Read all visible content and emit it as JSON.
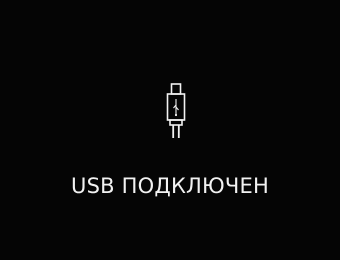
{
  "screen": {
    "background_color": "#050505",
    "text_color": "#f2f2f2",
    "icon": "usb-plug-icon",
    "status_text": "USB ПОДКЛЮЧЕН"
  }
}
